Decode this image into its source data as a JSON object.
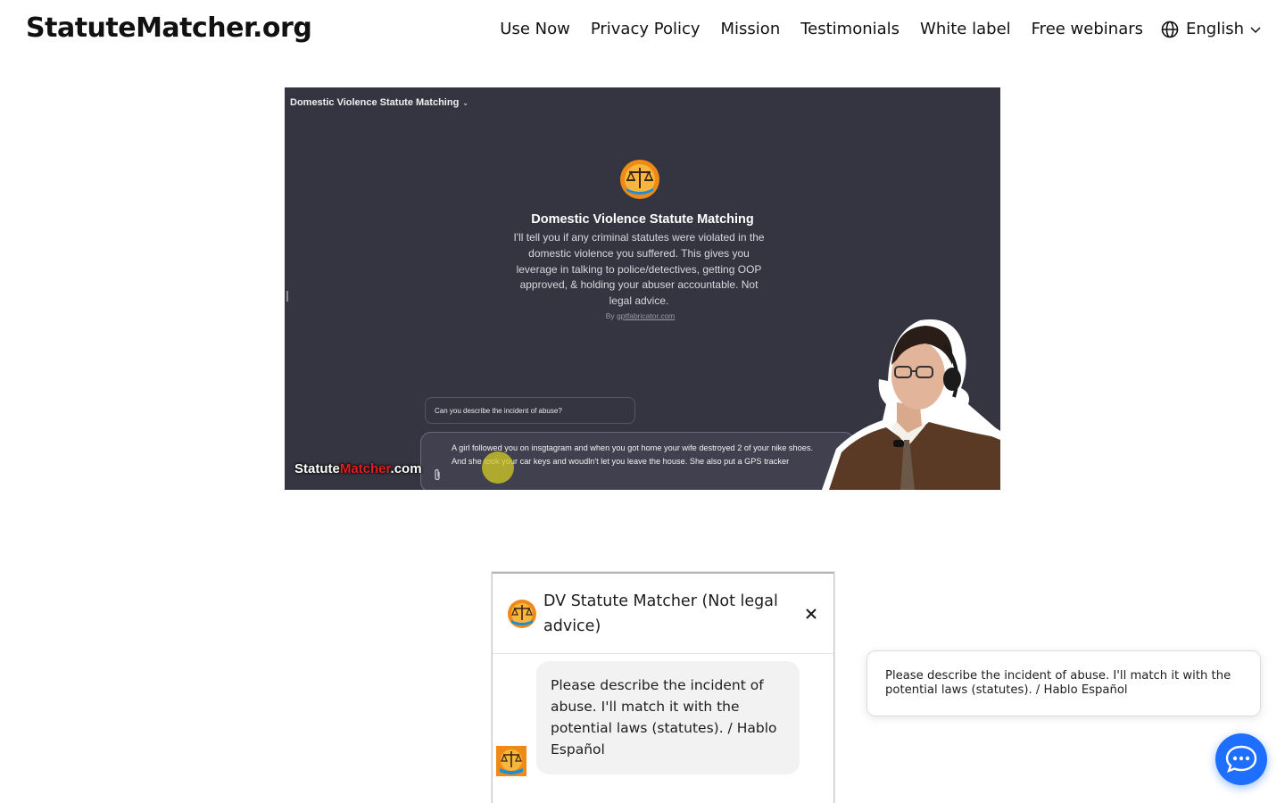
{
  "header": {
    "logo": "StatuteMatcher.org",
    "nav": [
      "Use Now",
      "Privacy Policy",
      "Mission",
      "Testimonials",
      "White label",
      "Free webinars"
    ],
    "language": "English"
  },
  "video": {
    "top_title": "Domestic Violence Statute Matching",
    "heading": "Domestic Violence Statute Matching",
    "description": "I'll tell you if any criminal statutes were violated in the domestic violence you suffered. This gives you leverage in talking to police/detectives, getting OOP approved, & holding your abuser accountable. Not legal advice.",
    "by_prefix": "By",
    "by_link": "gptfabricator.com",
    "suggestion": "Can you describe the incident of abuse?",
    "typed_message": "A girl followed you on insgtagram and when you got home your wife destroyed 2 of your nike shoes. And she took your car keys and woudln't let you leave the house. She also put a GPS tracker",
    "brand_white": "Statute",
    "brand_red": "Matcher",
    "brand_suffix": ".com"
  },
  "chat": {
    "title": "DV Statute Matcher (Not legal advice)",
    "message": "Please describe the incident of abuse. I'll match it with the potential laws (statutes). / Hablo Español"
  },
  "tooltip": {
    "text": "Please describe the incident of abuse. I'll match it with the potential laws (statutes). / Hablo Español"
  },
  "icons": {
    "language": "globe-icon",
    "dropdown": "chevron-down-icon",
    "close": "close-icon",
    "launcher": "chat-bubble-icon",
    "attach": "paperclip-icon"
  },
  "colors": {
    "launcher": "#1e6fff",
    "video_bg": "#353541",
    "brand_red": "#e41e1e"
  }
}
